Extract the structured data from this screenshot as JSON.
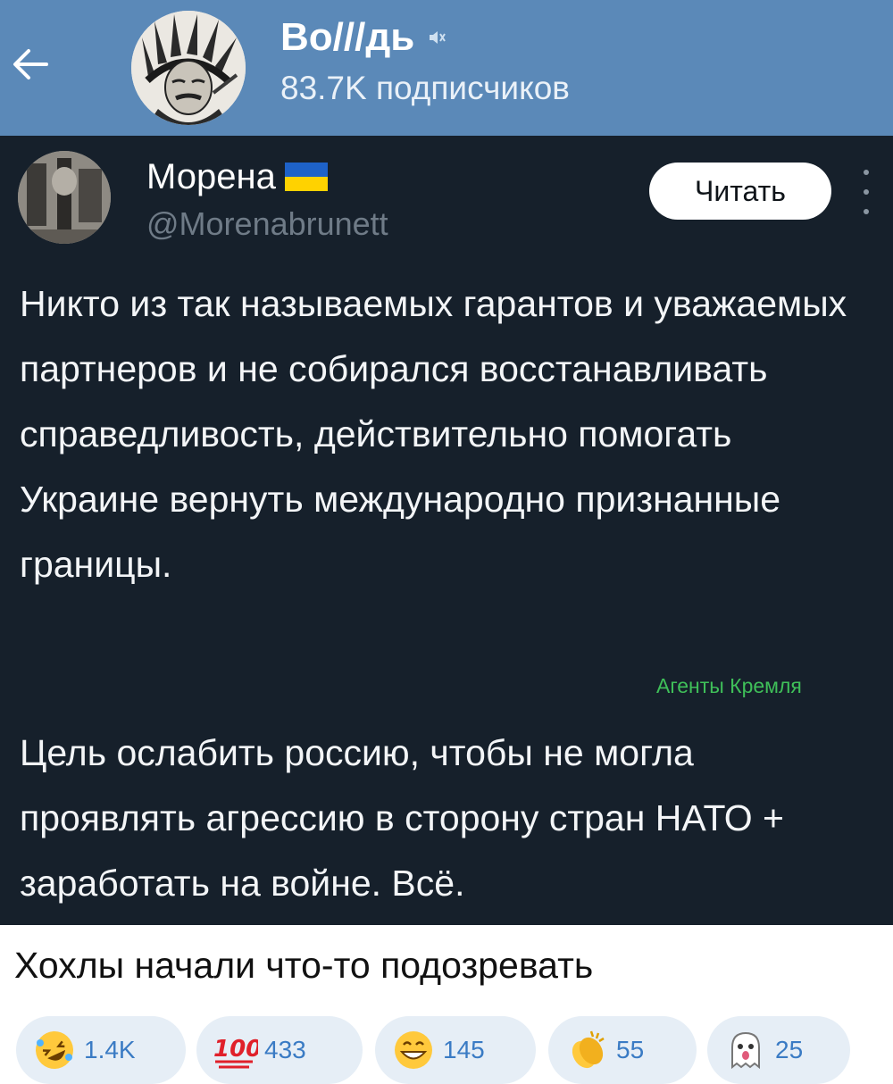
{
  "header": {
    "channel_title": "Во///дь",
    "subscribers": "83.7K подписчиков",
    "icons": {
      "back": "arrow-left-icon",
      "muted": "muted-speaker-icon"
    }
  },
  "tweet": {
    "author_name": "Морена",
    "author_handle": "@Morenabrunett",
    "read_button": "Читать",
    "paragraph_1": "Никто из так называемых гарантов и уважаемых партнеров и не собирался восстанавливать справедливость, действительно помогать Украине вернуть международно признанные границы.",
    "watermark": "Агенты Кремля",
    "paragraph_2": "Цель ослабить россию, чтобы не могла проявлять агрессию в сторону стран НАТО + заработать на войне. Всё.",
    "colors": {
      "background": "#16202b",
      "flag_blue": "#1e62c8",
      "flag_yellow": "#ffd200",
      "watermark": "#3fbf59"
    }
  },
  "caption": "Хохлы начали что-то подозревать",
  "reactions": [
    {
      "emoji": "rolling-laughing-emoji",
      "count": "1.4K"
    },
    {
      "emoji": "hundred-points-emoji",
      "count": "433"
    },
    {
      "emoji": "grinning-face-emoji",
      "count": "145"
    },
    {
      "emoji": "clapping-hands-emoji",
      "count": "55"
    },
    {
      "emoji": "ghost-emoji",
      "count": "25"
    }
  ],
  "colors": {
    "header_bg": "#5b89b8",
    "reaction_text": "#3a7bc4",
    "reaction_bg": "#e6eef6"
  }
}
